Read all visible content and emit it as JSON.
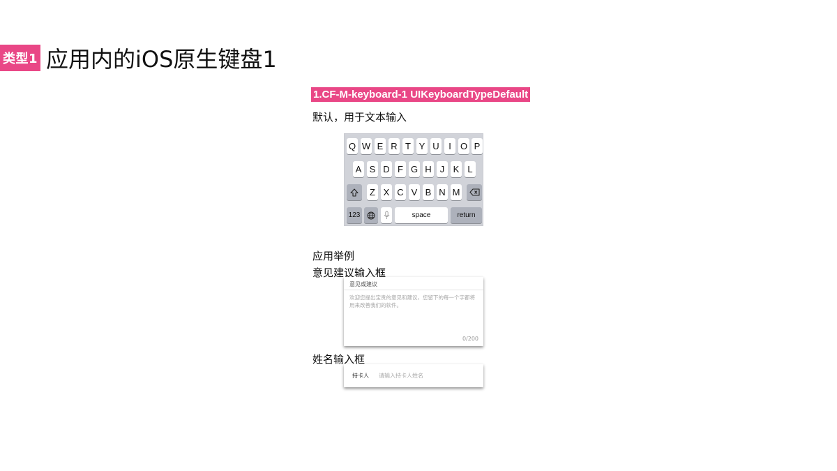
{
  "header": {
    "badge": "类型1",
    "title": "应用内的iOS原生键盘1"
  },
  "spec": {
    "label": "1.CF-M-keyboard-1 UIKeyboardTypeDefault",
    "description": "默认，用于文本输入"
  },
  "keyboard": {
    "row1": [
      "Q",
      "W",
      "E",
      "R",
      "T",
      "Y",
      "U",
      "I",
      "O",
      "P"
    ],
    "row2": [
      "A",
      "S",
      "D",
      "F",
      "G",
      "H",
      "J",
      "K",
      "L"
    ],
    "row3": [
      "Z",
      "X",
      "C",
      "V",
      "B",
      "N",
      "M"
    ],
    "shift_icon": "shift-icon",
    "delete_icon": "backspace-icon",
    "numbers_label": "123",
    "globe_icon": "globe-icon",
    "mic_icon": "microphone-icon",
    "space_label": "space",
    "return_label": "return"
  },
  "examples": {
    "heading": "应用举例",
    "feedback": {
      "section_label": "意见建议输入框",
      "header": "意见或建议",
      "placeholder": "欢迎您提出宝贵的意见和建议，您留下的每一个字都将用来改善我们的软件。",
      "counter": "0/200"
    },
    "name": {
      "section_label": "姓名输入框",
      "field_label": "持卡人",
      "placeholder": "请输入持卡人姓名"
    }
  }
}
